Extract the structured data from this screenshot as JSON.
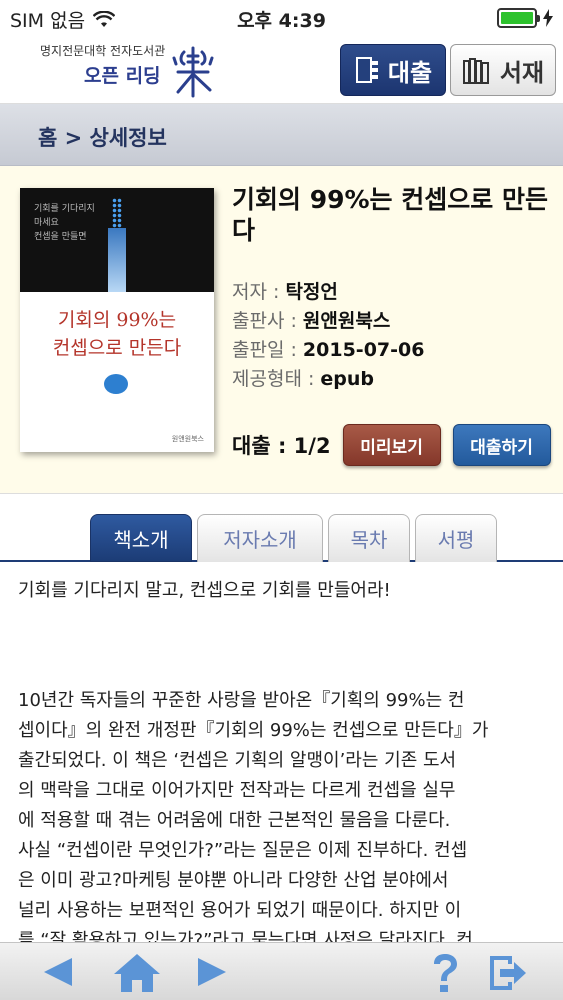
{
  "status_bar": {
    "carrier": "SIM 없음",
    "time": "오후 4:39",
    "battery_level": 1.0,
    "colors": {
      "battery": "#2dc22d"
    }
  },
  "header": {
    "university": "명지전문대학 전자도서관",
    "brand": "오픈 리딩",
    "loan_button": "대출",
    "shelf_button": "서재",
    "colors": {
      "primary": "#1c3570"
    }
  },
  "breadcrumb": "홈 > 상세정보",
  "book": {
    "title_line1": "기회의 99%는 컨셉으로 만든",
    "title_line2": "다",
    "author_label": "저자 : ",
    "author": "탁정언",
    "publisher_label": "출판사 : ",
    "publisher": "원앤원북스",
    "date_label": "출판일 : ",
    "date": "2015-07-06",
    "format_label": "제공형태 : ",
    "format": "epub",
    "loan_status": "대출 : 1/2",
    "preview_button": "미리보기",
    "borrow_button": "대출하기"
  },
  "cover": {
    "tagline": [
      "기회를 기다리지",
      "마세요",
      "컨셉을 만들면"
    ],
    "title_line1": "기회의 99%는",
    "title_line2": "컨셉으로 만든다",
    "publisher": "원앤원북스"
  },
  "tabs": [
    {
      "label": "책소개",
      "active": true
    },
    {
      "label": "저자소개",
      "active": false
    },
    {
      "label": "목차",
      "active": false
    },
    {
      "label": "서평",
      "active": false
    }
  ],
  "content": {
    "headline": "기회를 기다리지 말고, 컨셉으로 기회를 만들어라!",
    "body_lines": [
      "10년간 독자들의 꾸준한 사랑을 받아온『기획의 99%는 컨",
      "셉이다』의 완전 개정판『기회의 99%는 컨셉으로 만든다』가",
      "출간되었다. 이 책은 ‘컨셉은 기획의 알맹이’라는 기존 도서",
      "의 맥락을 그대로 이어가지만 전작과는 다르게 컨셉을 실무",
      "에 적용할 때 겪는 어려움에 대한 근본적인 물음을 다룬다.",
      "사실 “컨셉이란 무엇인가?”라는 질문은 이제 진부하다. 컨셉",
      "은 이미 광고?마케팅 분야뿐 아니라 다양한 산업 분야에서",
      "널리 사용하는 보편적인 용어가 되었기 때문이다. 하지만 이",
      "를 “잘 활용하고 있는가?”라고 묻는다면 사정은 달라진다. 컨"
    ]
  },
  "bottom_bar": {
    "icons": [
      "back-arrow-icon",
      "home-icon",
      "forward-arrow-icon",
      "help-icon",
      "logout-icon"
    ],
    "colors": {
      "icon": "#5b94d6"
    }
  }
}
